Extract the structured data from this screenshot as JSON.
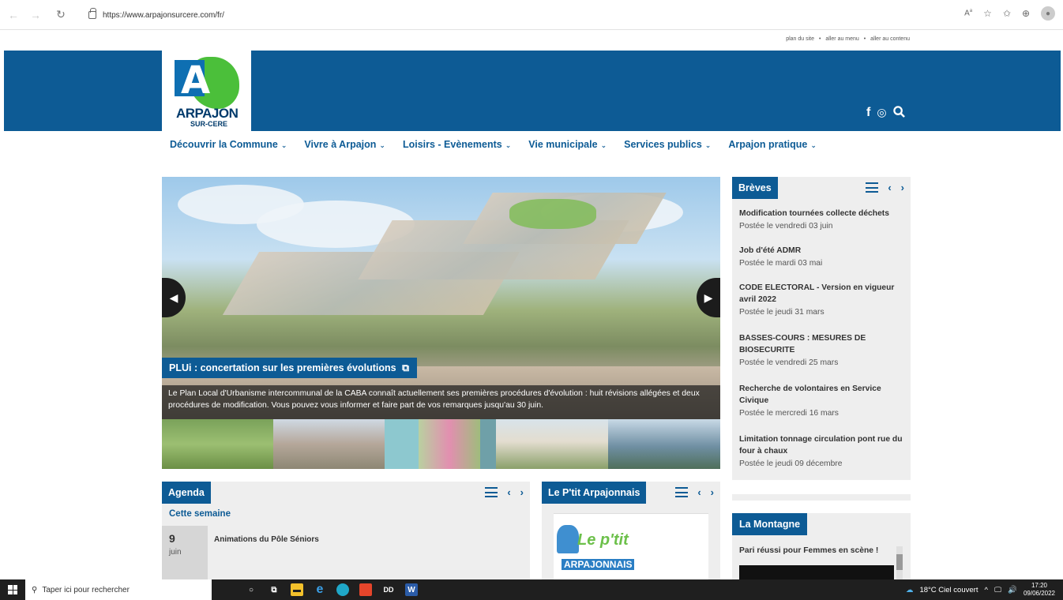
{
  "browser": {
    "url": "https://www.arpajonsurcere.com/fr/"
  },
  "toplinks": {
    "plan": "plan du site",
    "menu": "aller au menu",
    "contenu": "aller au contenu",
    "sep": "•"
  },
  "logo": {
    "letter": "A",
    "line1": "ARPAJON",
    "line2": "SUR-CERE"
  },
  "social": {
    "facebook": "f",
    "instagram": "◎",
    "search": "🔍"
  },
  "nav": [
    {
      "label": "Découvrir la Commune"
    },
    {
      "label": "Vivre à Arpajon"
    },
    {
      "label": "Loisirs - Evènements"
    },
    {
      "label": "Vie municipale"
    },
    {
      "label": "Services publics"
    },
    {
      "label": "Arpajon pratique"
    }
  ],
  "hero": {
    "title": "PLUi : concertation sur les premières évolutions",
    "description": "Le Plan Local d'Urbanisme intercommunal de la CABA connaît actuellement ses premières procédures d'évolution : huit révisions allégées et deux procédures de modification. Vous pouvez vous informer et faire part de vos remarques jusqu'au 30 juin."
  },
  "breves": {
    "title": "Brèves",
    "items": [
      {
        "title": "Modification tournées collecte déchets",
        "date": "Postée le vendredi 03 juin"
      },
      {
        "title": "Job d'été ADMR",
        "date": "Postée le mardi 03 mai"
      },
      {
        "title": "CODE ELECTORAL - Version en vigueur avril 2022",
        "date": "Postée le jeudi 31 mars"
      },
      {
        "title": "BASSES-COURS : MESURES DE BIOSECURITE",
        "date": "Postée le vendredi 25 mars"
      },
      {
        "title": "Recherche de volontaires en Service Civique",
        "date": "Postée le mercredi 16 mars"
      },
      {
        "title": "Limitation tonnage circulation pont rue du four à chaux",
        "date": "Postée le jeudi 09 décembre"
      }
    ]
  },
  "agenda": {
    "title": "Agenda",
    "week": "Cette semaine",
    "day": "9",
    "month": "juin",
    "event": "Animations du Pôle Séniors"
  },
  "ptit": {
    "title": "Le P'tit Arpajonnais",
    "logo1": "Le p'tit",
    "logo2": "ARPAJONNAIS"
  },
  "montagne": {
    "title": "La Montagne",
    "article": "Pari réussi pour Femmes en scène !"
  },
  "taskbar": {
    "search": "Taper ici pour rechercher",
    "weather": "18°C  Ciel couvert",
    "time": "17:20",
    "date": "09/06/2022"
  }
}
